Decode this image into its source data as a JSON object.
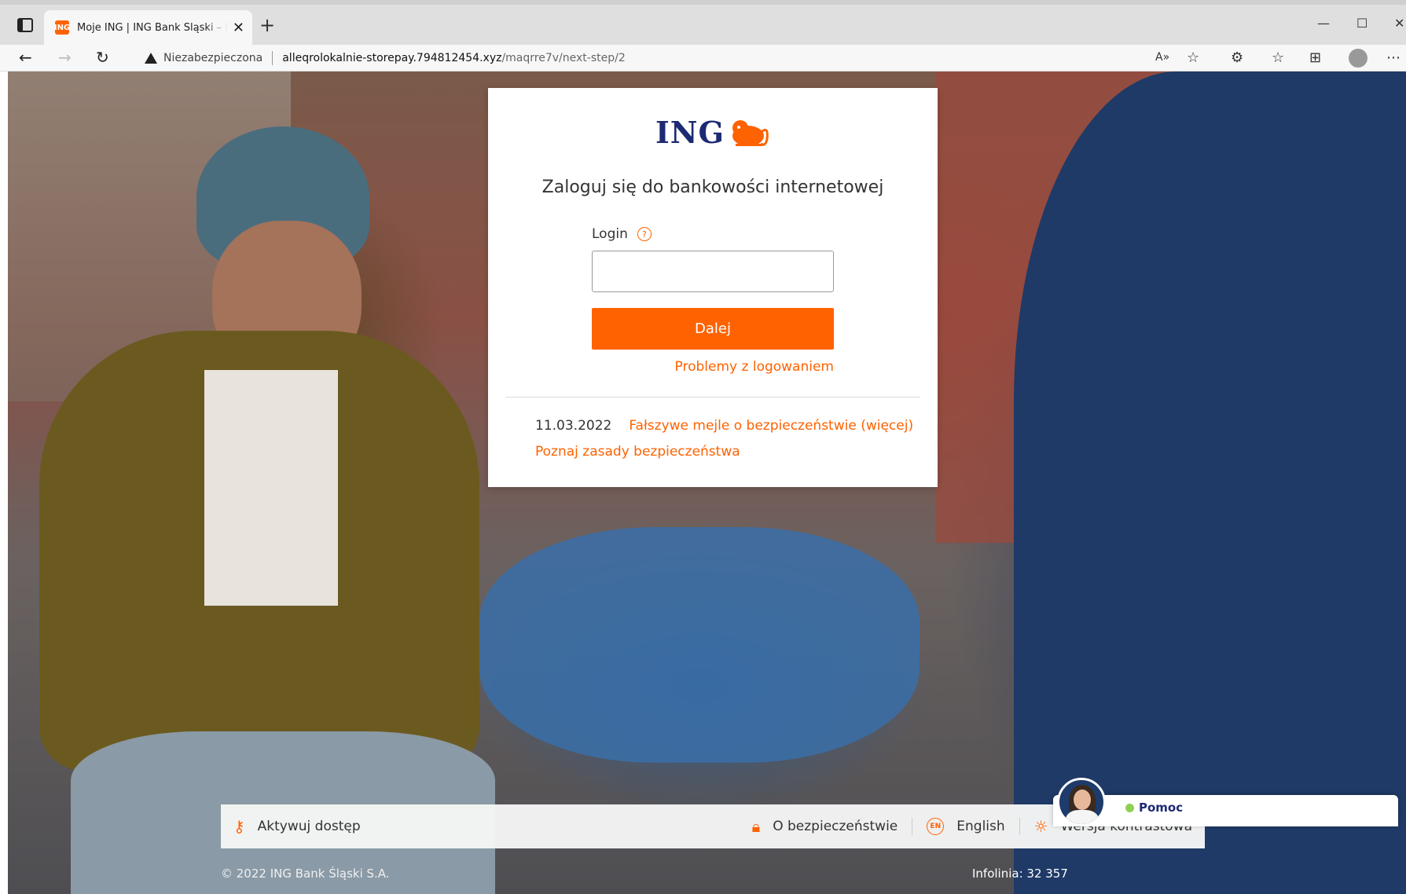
{
  "browser": {
    "tab_title": "Moje ING | ING Bank Śląski – Moje ING",
    "favicon_text": "ING",
    "security_label": "Niezabezpieczona",
    "url_host": "alleqrolokalnie-storepay.794812454.xyz",
    "url_path": "/maqrre7v/next-step/2"
  },
  "login": {
    "logo_text": "ING",
    "title": "Zaloguj się do bankowości internetowej",
    "login_label": "Login",
    "login_value": "",
    "next_button": "Dalej",
    "problems_link": "Problemy z logowaniem",
    "news_date": "11.03.2022",
    "news_link": "Fałszywe mejle o bezpieczeństwie (więcej)",
    "security_link": "Poznaj zasady bezpieczeństwa"
  },
  "footer": {
    "activate": "Aktywuj dostęp",
    "security": "O bezpieczeństwie",
    "english": "English",
    "contrast": "Wersja kontrastowa",
    "copyright": "© 2022 ING Bank Śląski S.A.",
    "infolinia": "Infolinia: 32 357",
    "help": "Pomoc"
  },
  "colors": {
    "accent": "#ff6200",
    "brand_navy": "#1d2a73",
    "status_online": "#8fd14f"
  }
}
